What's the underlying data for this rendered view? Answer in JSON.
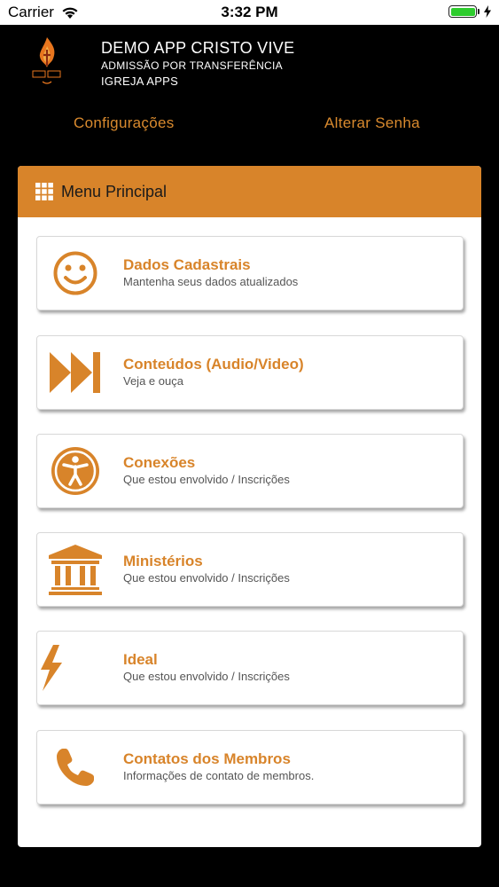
{
  "status_bar": {
    "carrier": "Carrier",
    "time": "3:32 PM"
  },
  "header": {
    "title": "DEMO APP CRISTO VIVE",
    "subtitle": "ADMISSÃO POR TRANSFERÊNCIA",
    "church": "IGREJA APPS",
    "links": {
      "settings": "Configurações",
      "change_password": "Alterar Senha"
    }
  },
  "panel": {
    "title": "Menu Principal",
    "items": [
      {
        "icon": "smiley-icon",
        "title": "Dados Cadastrais",
        "description": "Mantenha seus dados atualizados"
      },
      {
        "icon": "fast-forward-icon",
        "title": "Conteúdos (Audio/Video)",
        "description": "Veja e ouça"
      },
      {
        "icon": "accessibility-icon",
        "title": "Conexões",
        "description": "Que estou envolvido / Inscrições"
      },
      {
        "icon": "institution-icon",
        "title": "Ministérios",
        "description": "Que estou envolvido / Inscrições"
      },
      {
        "icon": "lightning-icon",
        "title": "Ideal",
        "description": "Que estou envolvido / Inscrições"
      },
      {
        "icon": "phone-icon",
        "title": "Contatos dos Membros",
        "description": "Informações de contato de membros."
      }
    ]
  },
  "colors": {
    "accent": "#d8842a",
    "link": "#d98a2e",
    "background": "#000000",
    "battery": "#2ecc2e"
  }
}
